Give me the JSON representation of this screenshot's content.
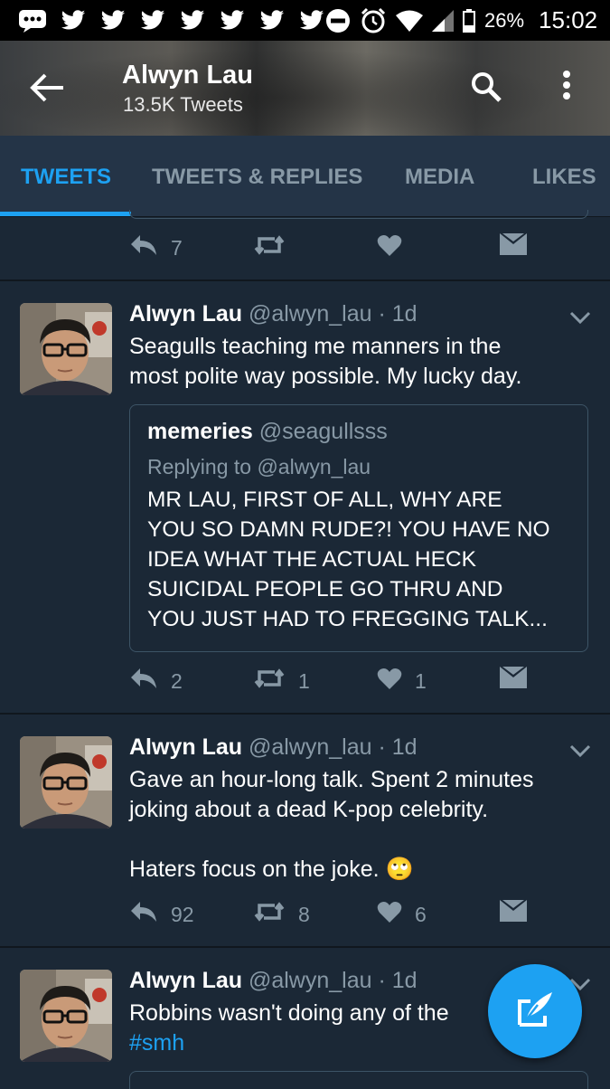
{
  "status_bar": {
    "battery_percent": "26%",
    "time": "15:02",
    "notification_icons": [
      "messages-icon",
      "twitter-icon",
      "twitter-icon",
      "twitter-icon",
      "twitter-icon",
      "twitter-icon",
      "twitter-icon",
      "twitter-icon"
    ]
  },
  "header": {
    "title": "Alwyn Lau",
    "subtitle": "13.5K Tweets"
  },
  "tabs": [
    {
      "label": "TWEETS",
      "active": true
    },
    {
      "label": "TWEETS & REPLIES",
      "active": false
    },
    {
      "label": "MEDIA",
      "active": false
    },
    {
      "label": "LIKES",
      "active": false
    }
  ],
  "prev_tweet": {
    "replies": "7"
  },
  "tweets": [
    {
      "name": "Alwyn Lau",
      "meta": "@alwyn_lau · 1d",
      "lines": [
        "Seagulls teaching me manners in the",
        "most polite way possible. My lucky day."
      ],
      "quote": {
        "name": "memeries",
        "handle": "@seagullsss",
        "replying": "Replying to @alwyn_lau",
        "lines": [
          "MR LAU, FIRST OF ALL, WHY ARE",
          "YOU SO DAMN RUDE?! YOU HAVE NO",
          "IDEA WHAT THE ACTUAL HECK",
          "SUICIDAL PEOPLE GO THRU AND",
          "YOU JUST HAD TO FREGGING TALK..."
        ]
      },
      "replies": "2",
      "retweets": "1",
      "likes": "1"
    },
    {
      "name": "Alwyn Lau",
      "meta": "@alwyn_lau · 1d",
      "lines": [
        "Gave an hour-long talk. Spent 2 minutes",
        "joking about a dead K-pop celebrity.",
        "Haters focus on the joke. 🙄"
      ],
      "replies": "92",
      "retweets": "8",
      "likes": "6"
    },
    {
      "name": "Alwyn Lau",
      "meta": "@alwyn_lau · 1d",
      "lines": [
        "Robbins wasn't doing any of the"
      ],
      "hashtag": "#smh"
    }
  ],
  "colors": {
    "background": "#1b2836",
    "accent": "#1da1f2",
    "muted": "#8899a6"
  }
}
